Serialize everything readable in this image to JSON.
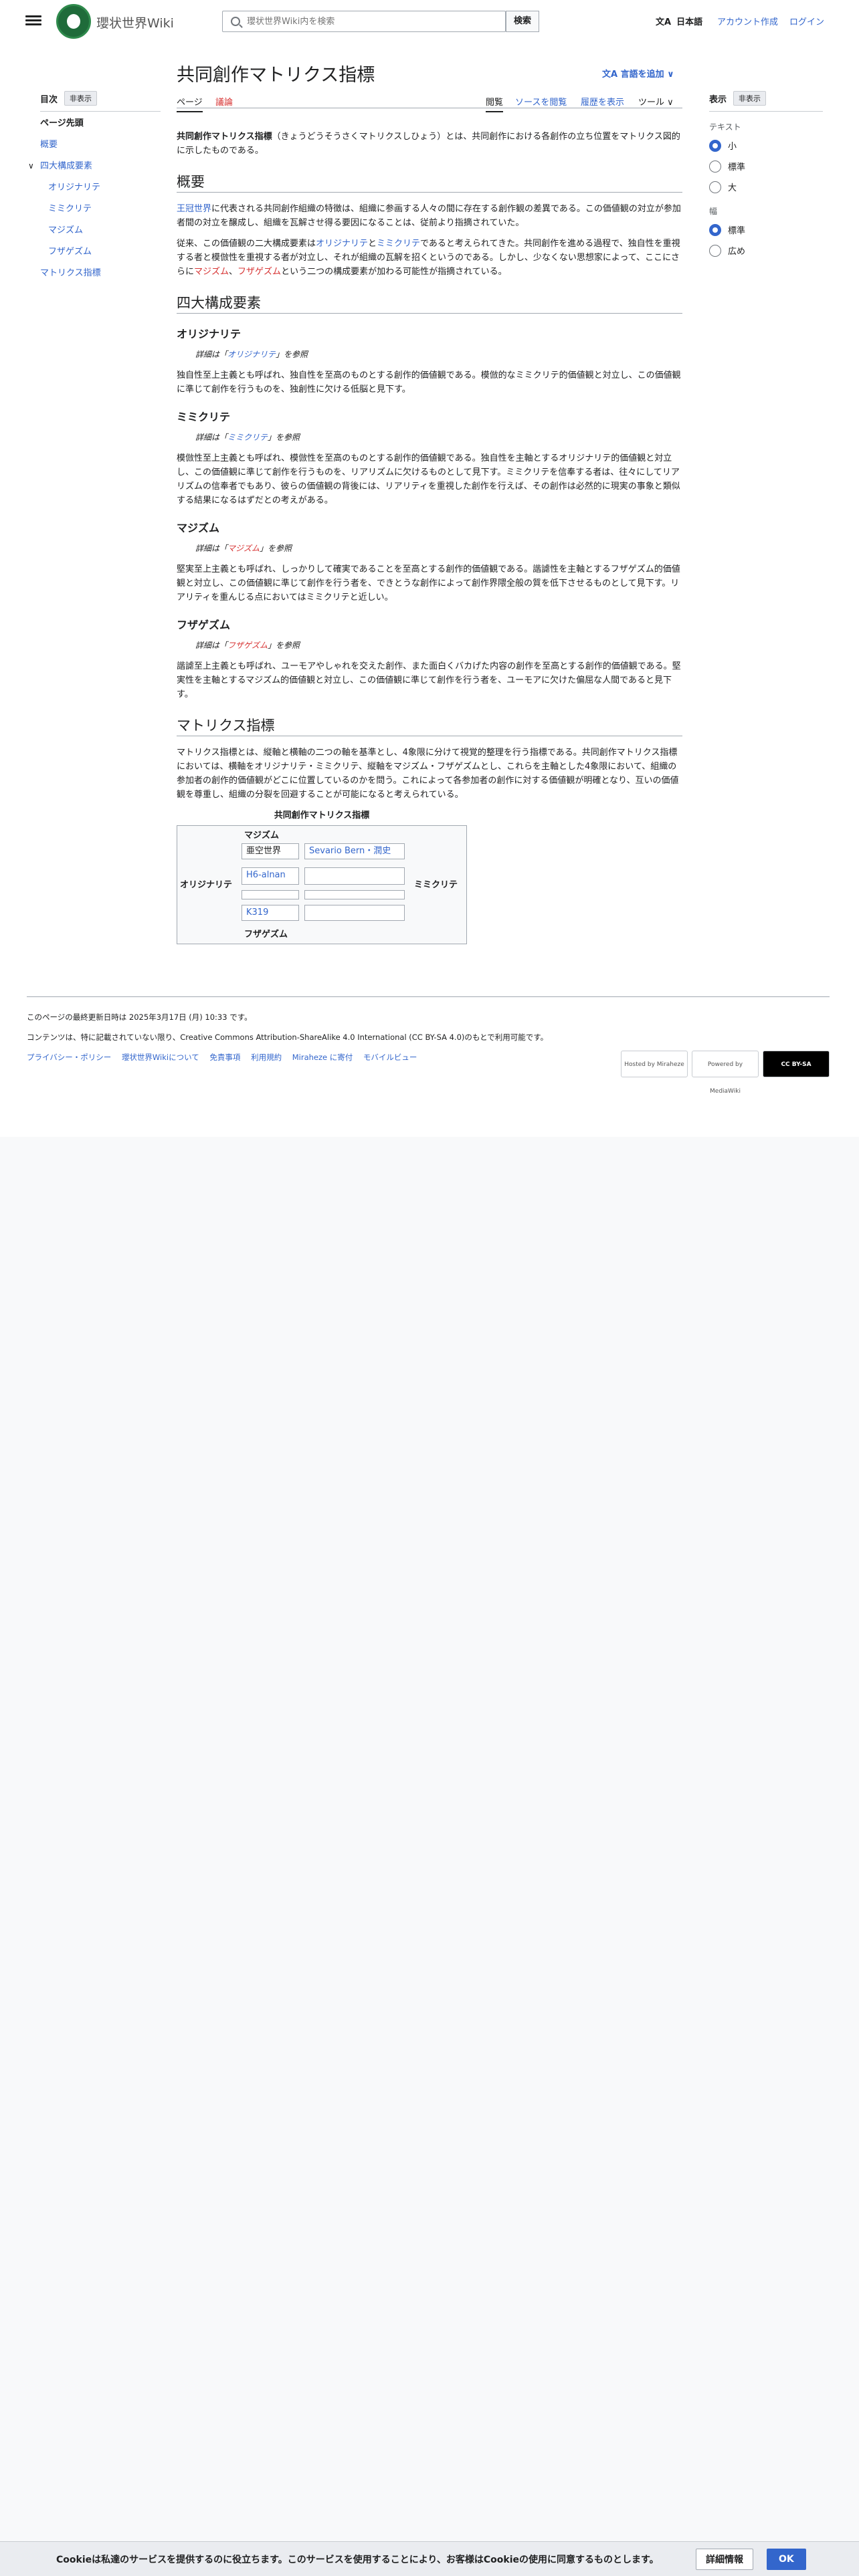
{
  "header": {
    "site_name": "瓔状世界Wiki",
    "search_placeholder": "瓔状世界Wiki内を検索",
    "search_button": "検索",
    "language": "日本語",
    "create_account": "アカウント作成",
    "login": "ログイン"
  },
  "toc": {
    "title": "目次",
    "hide": "非表示",
    "items": [
      "ページ先頭",
      "概要",
      "四大構成要素",
      "オリジナリテ",
      "ミミクリテ",
      "マジズム",
      "フザゲズム",
      "マトリクス指標"
    ]
  },
  "article": {
    "title": "共同創作マトリクス指標",
    "add_languages": "言語を追加",
    "tabs": {
      "page": "ページ",
      "talk": "議論",
      "read": "閲覧",
      "view_source": "ソースを閲覧",
      "history": "履歴を表示",
      "tools": "ツール"
    },
    "intro_bold": "共同創作マトリクス指標",
    "intro_rest": "（きょうどうそうさくマトリクスしひょう）とは、共同創作における各創作の立ち位置をマトリクス図的に示したものである。",
    "overview_heading": "概要",
    "overview_p1_link": "王冠世界",
    "overview_p1": "に代表される共同創作組織の特徴は、組織に参画する人々の間に存在する創作観の差異である。この価値観の対立が参加者間の対立を醸成し、組織を瓦解させ得る要因になることは、従前より指摘されていた。",
    "overview_p2_a": "従来、この価値観の二大構成要素は",
    "overview_p2_link1": "オリジナリテ",
    "overview_p2_b": "と",
    "overview_p2_link2": "ミミクリテ",
    "overview_p2_c": "であると考えられてきた。共同創作を進める過程で、独自性を重視する者と模倣性を重視する者が対立し、それが組織の瓦解を招くというのである。しかし、少なくない思想家によって、ここにさらに",
    "overview_p2_link3": "マジズム",
    "overview_p2_d": "、",
    "overview_p2_link4": "フザゲズム",
    "overview_p2_e": "という二つの構成要素が加わる可能性が指摘されている。",
    "four_heading": "四大構成要素",
    "sections": [
      {
        "title": "オリジナリテ",
        "hat_pre": "詳細は「",
        "hat_link": "オリジナリテ",
        "hat_post": "」を参照",
        "body": "独自性至上主義とも呼ばれ、独自性を至高のものとする創作的価値観である。模倣的なミミクリテ的価値観と対立し、この価値観に準じて創作を行うものを、独創性に欠ける低脳と見下す。"
      },
      {
        "title": "ミミクリテ",
        "hat_pre": "詳細は「",
        "hat_link": "ミミクリテ",
        "hat_post": "」を参照",
        "body": "模倣性至上主義とも呼ばれ、模倣性を至高のものとする創作的価値観である。独自性を主軸とするオリジナリテ的価値観と対立し、この価値観に準じて創作を行うものを、リアリズムに欠けるものとして見下す。ミミクリテを信奉する者は、往々にしてリアリズムの信奉者でもあり、彼らの価値観の背後には、リアリティを重視した創作を行えば、その創作は必然的に現実の事象と類似する結果になるはずだとの考えがある。"
      },
      {
        "title": "マジズム",
        "hat_pre": "詳細は「",
        "hat_link": "マジズム",
        "hat_post": "」を参照",
        "body": "堅実至上主義とも呼ばれ、しっかりして確実であることを至高とする創作的価値観である。諧謔性を主軸とするフザゲズム的価値観と対立し、この価値観に準じて創作を行う者を、できとうな創作によって創作界隈全般の質を低下させるものとして見下す。リアリティを重んじる点においてはミミクリテと近しい。"
      },
      {
        "title": "フザゲズム",
        "hat_pre": "詳細は「",
        "hat_link": "フザゲズム",
        "hat_post": "」を参照",
        "body": "諧謔至上主義とも呼ばれ、ユーモアやしゃれを交えた創作、また面白くバカげた内容の創作を至高とする創作的価値観である。堅実性を主軸とするマジズム的価値観と対立し、この価値観に準じて創作を行う者を、ユーモアに欠けた偏屈な人間であると見下す。"
      }
    ],
    "matrix_heading": "マトリクス指標",
    "matrix_body": "マトリクス指標とは、縦軸と横軸の二つの軸を基準とし、4象限に分けて視覚的整理を行う指標である。共同創作マトリクス指標においては、横軸をオリジナリテ・ミミクリテ、縦軸をマジズム・フザゲズムとし、これらを主軸とした4象限において、組織の参加者の創作的価値観がどこに位置しているのかを問う。これによって各参加者の創作に対する価値観が明確となり、互いの価値観を尊重し、組織の分裂を回避することが可能になると考えられている。",
    "matrix_table": {
      "caption": "共同創作マトリクス指標",
      "top": "マジズム",
      "bottom": "フザゲズム",
      "left": "オリジナリテ",
      "right": "ミミクリテ",
      "cells": [
        "亜空世界",
        "Sevario Bern・潤史",
        "H6-alnan",
        "K319"
      ]
    }
  },
  "appearance": {
    "title": "表示",
    "hide": "非表示",
    "text_label": "テキスト",
    "text_options": [
      "小",
      "標準",
      "大"
    ],
    "text_selected": 0,
    "width_label": "幅",
    "width_options": [
      "標準",
      "広め"
    ],
    "width_selected": 0
  },
  "footer": {
    "last_edited": "このページの最終更新日時は 2025年3月17日 (月) 10:33 です。",
    "license": "コンテンツは、特に記載されていない限り、Creative Commons Attribution-ShareAlike 4.0 International (CC BY-SA 4.0)のもとで利用可能です。",
    "links": [
      "プライバシー・ポリシー",
      "瓔状世界Wikiについて",
      "免責事項",
      "利用規約",
      "Miraheze に寄付",
      "モバイルビュー"
    ],
    "badges": [
      "Hosted by Miraheze",
      "Powered by MediaWiki",
      "CC BY-SA"
    ]
  },
  "cookie": {
    "text": "Cookieは私達のサービスを提供するのに役立ちます。このサービスを使用することにより、お客様はCookieの使用に同意するものとします。",
    "more": "詳細情報",
    "ok": "OK"
  }
}
